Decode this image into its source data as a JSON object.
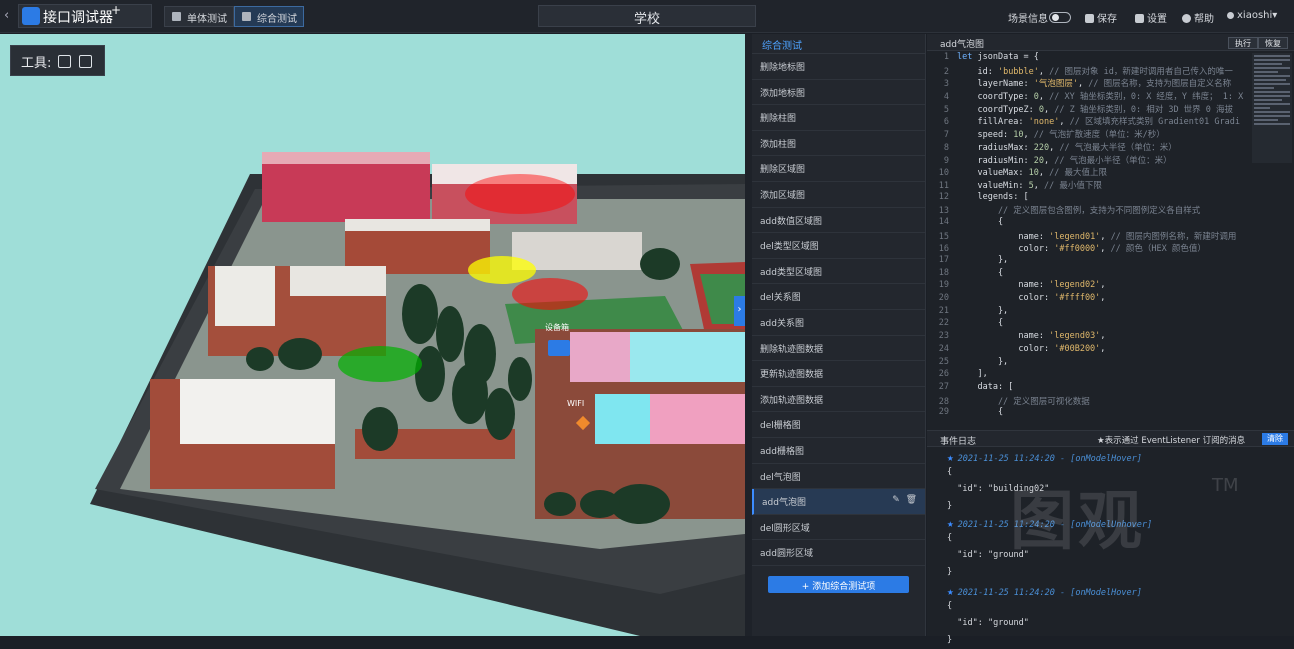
{
  "app": {
    "title": "接口调试器",
    "title_mark": "+"
  },
  "tabs": [
    {
      "label": "单体测试",
      "active": false
    },
    {
      "label": "综合测试",
      "active": true
    }
  ],
  "scene_title": "学校",
  "topright": {
    "scene_info": "场景信息",
    "save": "保存",
    "settings": "设置",
    "help": "帮助",
    "user": "xiaoshi"
  },
  "viewport": {
    "tools_label": "工具:",
    "labels": {
      "device": "设备箱",
      "wifi": "WIFI"
    }
  },
  "list": {
    "header": "综合测试",
    "items": [
      "删除地标图",
      "添加地标图",
      "删除柱图",
      "添加柱图",
      "删除区域图",
      "添加区域图",
      "add数值区域图",
      "del类型区域图",
      "add类型区域图",
      "del关系图",
      "add关系图",
      "删除轨迹图数据",
      "更新轨迹图数据",
      "添加轨迹图数据",
      "del栅格图",
      "add栅格图",
      "del气泡图",
      "add气泡图",
      "del圆形区域",
      "add圆形区域"
    ],
    "active_index": 17,
    "add_button": "+ 添加综合测试项"
  },
  "editor": {
    "title": "add气泡图",
    "run": "执行",
    "restore": "恢复",
    "lines": [
      [
        [
          "kw",
          "let "
        ],
        [
          "prop",
          "jsonData = {"
        ]
      ],
      [
        [
          "prop",
          "    id: "
        ],
        [
          "str",
          "'bubble'"
        ],
        [
          "prop",
          ", "
        ],
        [
          "cmt",
          "// 图层对象 id，新建时调用者自己传入的唯一"
        ]
      ],
      [
        [
          "prop",
          "    layerName: "
        ],
        [
          "str",
          "'气泡图层'"
        ],
        [
          "prop",
          ", "
        ],
        [
          "cmt",
          "// 图层名称，支持为图层自定义名称"
        ]
      ],
      [
        [
          "prop",
          "    coordType: "
        ],
        [
          "num",
          "0"
        ],
        [
          "prop",
          ", "
        ],
        [
          "cmt",
          "// XY 轴坐标类别，0: X 经度，Y 纬度； 1: X"
        ]
      ],
      [
        [
          "prop",
          "    coordTypeZ: "
        ],
        [
          "num",
          "0"
        ],
        [
          "prop",
          ", "
        ],
        [
          "cmt",
          "// Z 轴坐标类别，0: 相对 3D 世界 0 海拔"
        ]
      ],
      [
        [
          "prop",
          "    fillArea: "
        ],
        [
          "str",
          "'none'"
        ],
        [
          "prop",
          ", "
        ],
        [
          "cmt",
          "// 区域填充样式类别 Gradient01 Gradi"
        ]
      ],
      [
        [
          "prop",
          "    speed: "
        ],
        [
          "num",
          "10"
        ],
        [
          "prop",
          ", "
        ],
        [
          "cmt",
          "// 气泡扩散速度（单位：米/秒）"
        ]
      ],
      [
        [
          "prop",
          "    radiusMax: "
        ],
        [
          "num",
          "220"
        ],
        [
          "prop",
          ", "
        ],
        [
          "cmt",
          "// 气泡最大半径（单位：米）"
        ]
      ],
      [
        [
          "prop",
          "    radiusMin: "
        ],
        [
          "num",
          "20"
        ],
        [
          "prop",
          ", "
        ],
        [
          "cmt",
          "// 气泡最小半径（单位：米）"
        ]
      ],
      [
        [
          "prop",
          "    valueMax: "
        ],
        [
          "num",
          "10"
        ],
        [
          "prop",
          ", "
        ],
        [
          "cmt",
          "// 最大值上限"
        ]
      ],
      [
        [
          "prop",
          "    valueMin: "
        ],
        [
          "num",
          "5"
        ],
        [
          "prop",
          ", "
        ],
        [
          "cmt",
          "// 最小值下限"
        ]
      ],
      [
        [
          "prop",
          "    legends: ["
        ]
      ],
      [
        [
          "cmt",
          "        // 定义图层包含图例，支持为不同图例定义各自样式"
        ]
      ],
      [
        [
          "prop",
          "        {"
        ]
      ],
      [
        [
          "prop",
          "            name: "
        ],
        [
          "str",
          "'legend01'"
        ],
        [
          "prop",
          ", "
        ],
        [
          "cmt",
          "// 图层内图例名称，新建时调用"
        ]
      ],
      [
        [
          "prop",
          "            color: "
        ],
        [
          "str",
          "'#ff0000'"
        ],
        [
          "prop",
          ", "
        ],
        [
          "cmt",
          "// 颜色（HEX 颜色值）"
        ]
      ],
      [
        [
          "prop",
          "        },"
        ]
      ],
      [
        [
          "prop",
          "        {"
        ]
      ],
      [
        [
          "prop",
          "            name: "
        ],
        [
          "str",
          "'legend02'"
        ],
        [
          "prop",
          ","
        ]
      ],
      [
        [
          "prop",
          "            color: "
        ],
        [
          "str",
          "'#ffff00'"
        ],
        [
          "prop",
          ","
        ]
      ],
      [
        [
          "prop",
          "        },"
        ]
      ],
      [
        [
          "prop",
          "        {"
        ]
      ],
      [
        [
          "prop",
          "            name: "
        ],
        [
          "str",
          "'legend03'"
        ],
        [
          "prop",
          ","
        ]
      ],
      [
        [
          "prop",
          "            color: "
        ],
        [
          "str",
          "'#00B200'"
        ],
        [
          "prop",
          ","
        ]
      ],
      [
        [
          "prop",
          "        },"
        ]
      ],
      [
        [
          "prop",
          "    ],"
        ]
      ],
      [
        [
          "prop",
          "    data: ["
        ]
      ],
      [
        [
          "cmt",
          "        // 定义图层可视化数据"
        ]
      ],
      [
        [
          "prop",
          "        {"
        ]
      ]
    ]
  },
  "events": {
    "title": "事件日志",
    "note": "★表示通过 EventListener 订阅的消息",
    "clear": "清除",
    "items": [
      {
        "time": "2021-11-25 11:24:20 - [onModelHover]",
        "id": "\"building02\""
      },
      {
        "time": "2021-11-25 11:24:20 - [onModelUnhover]",
        "id": "\"ground\""
      },
      {
        "time": "2021-11-25 11:24:20 - [onModelHover]",
        "id": "\"ground\""
      }
    ]
  },
  "watermark": {
    "text": "图观",
    "mark": "TM"
  },
  "colors": {
    "accent": "#2c7be5",
    "bubble_red": "#ff0000",
    "bubble_yellow": "#ffff00",
    "bubble_green": "#00B200"
  }
}
